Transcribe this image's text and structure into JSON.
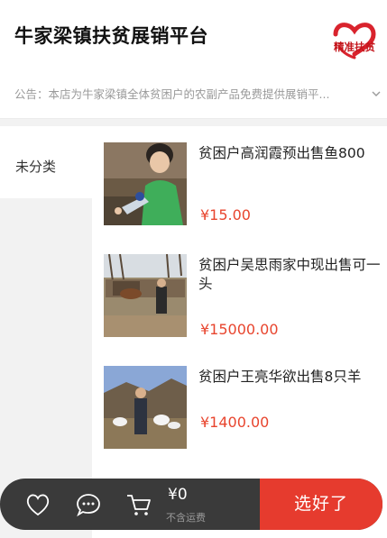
{
  "header": {
    "shop_name": "牛家梁镇扶贫展销平台",
    "logo_text": "精准扶贫",
    "notice": "公告：本店为牛家梁镇全体贫困户的农副产品免费提供展销平..."
  },
  "sidebar": {
    "items": [
      {
        "label": "未分类",
        "active": true
      }
    ]
  },
  "products": [
    {
      "title": "贫困户高润霞预出售鱼800",
      "price": "¥15.00",
      "image": "woman-holding-fish-photo"
    },
    {
      "title": "贫困户吴思雨家中现出售可一头",
      "price": "¥15000.00",
      "image": "cow-shed-photo"
    },
    {
      "title": "贫困户王亮华欲出售8只羊",
      "price": "¥1400.00",
      "image": "man-with-sheep-photo"
    }
  ],
  "cart": {
    "total": "¥0",
    "shipping_note": "不含运费",
    "checkout_label": "选好了",
    "icons": [
      "heart-icon",
      "chat-icon",
      "cart-icon"
    ]
  },
  "colors": {
    "price": "#e8452e",
    "checkout": "#e63b2e",
    "cart_bar": "#3a3a3a",
    "logo_red": "#d9232d"
  }
}
